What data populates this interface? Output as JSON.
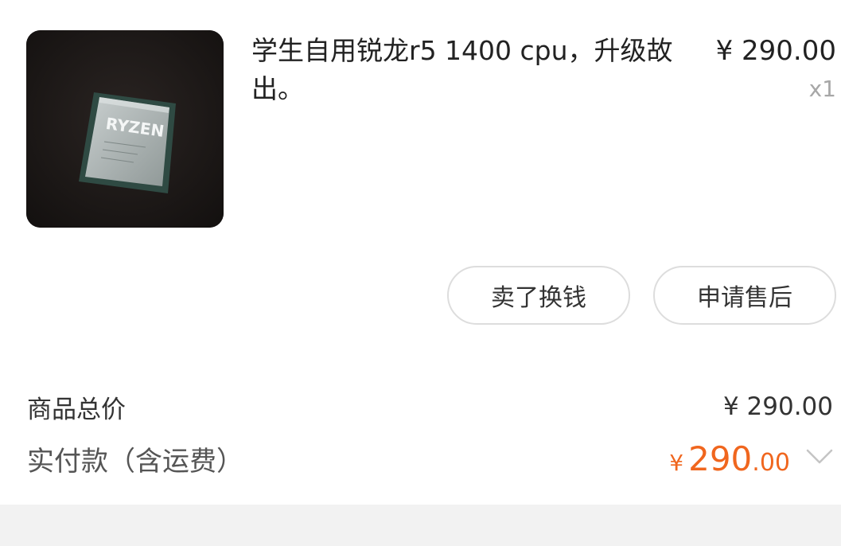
{
  "product": {
    "title": "学生自用锐龙r5 1400 cpu，升级故出。",
    "price": "¥ 290.00",
    "quantity": "x1",
    "image_label": "RYZEN"
  },
  "actions": {
    "sell_label": "卖了换钱",
    "after_sale_label": "申请售后"
  },
  "summary": {
    "subtotal_label": "商品总价",
    "subtotal_value": "¥ 290.00",
    "paid_label": "实付款（含运费）",
    "paid_symbol": "¥",
    "paid_integer": "290",
    "paid_decimal": ".00"
  },
  "colors": {
    "accent": "#f0661e",
    "muted_text": "#a7a7a7",
    "footer_band": "#f2f2f2"
  }
}
